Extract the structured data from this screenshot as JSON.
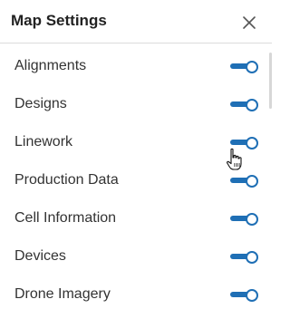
{
  "panel": {
    "title": "Map Settings"
  },
  "accent_color": "#1f6fb5",
  "icons": {
    "close": "close-icon",
    "cursor": "hand-pointer-icon"
  },
  "settings": [
    {
      "label": "Alignments",
      "enabled": true
    },
    {
      "label": "Designs",
      "enabled": true
    },
    {
      "label": "Linework",
      "enabled": true
    },
    {
      "label": "Production Data",
      "enabled": true
    },
    {
      "label": "Cell Information",
      "enabled": true
    },
    {
      "label": "Devices",
      "enabled": true
    },
    {
      "label": "Drone Imagery",
      "enabled": true
    }
  ]
}
